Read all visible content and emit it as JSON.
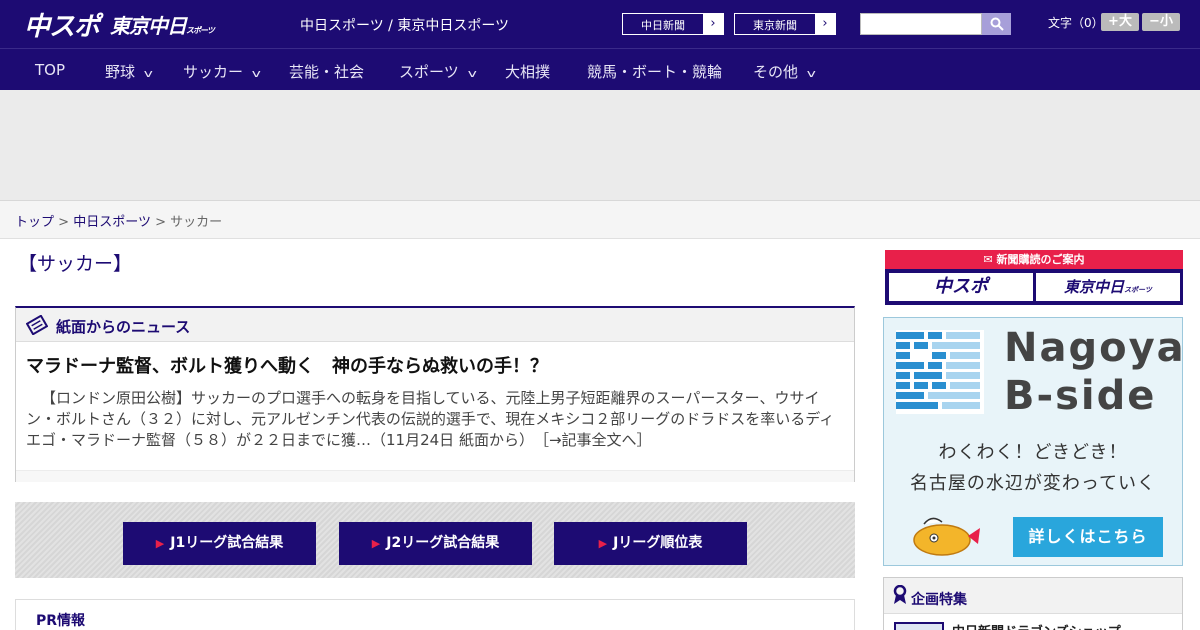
{
  "header": {
    "logo_chuspo": "中スポ",
    "logo_tokyo": "東京中日",
    "logo_tokyo_small": "スポーツ",
    "tagline": "中日スポーツ / 東京中日スポーツ",
    "paper_links": [
      "中日新聞",
      "東京新聞"
    ],
    "search_placeholder": "",
    "font_size_label": "文字（0）",
    "font_bigger": "+大",
    "font_smaller": "−小"
  },
  "nav": [
    {
      "label": "TOP",
      "has_dropdown": false
    },
    {
      "label": "野球",
      "has_dropdown": true
    },
    {
      "label": "サッカー",
      "has_dropdown": true
    },
    {
      "label": "芸能・社会",
      "has_dropdown": false
    },
    {
      "label": "スポーツ",
      "has_dropdown": true
    },
    {
      "label": "大相撲",
      "has_dropdown": false
    },
    {
      "label": "競馬・ボート・競輪",
      "has_dropdown": false
    },
    {
      "label": "その他",
      "has_dropdown": true
    }
  ],
  "breadcrumb": {
    "home": "トップ",
    "sep": ">",
    "section": "中日スポーツ",
    "current": "サッカー"
  },
  "page_title": "【サッカー】",
  "news": {
    "section_title": "紙面からのニュース",
    "headline": "マラドーナ監督、ボルト獲りへ動く　神の手ならぬ救いの手！？",
    "body": "【ロンドン原田公樹】サッカーのプロ選手への転身を目指している、元陸上男子短距離界のスーパースター、ウサイン・ボルトさん（３２）に対し、元アルゼンチン代表の伝説的選手で、現在メキシコ２部リーグのドラドスを率いるディエゴ・マラドーナ監督（５８）が２２日までに獲…（11月24日 紙面から）",
    "more_link": "［→記事全文へ］"
  },
  "results_buttons": [
    "J1リーグ試合結果",
    "J2リーグ試合結果",
    "Jリーグ順位表"
  ],
  "pr": {
    "title": "PR情報"
  },
  "sidebar": {
    "subscribe_label": "新聞購読のご案内",
    "subscribe_logos": [
      "中スポ",
      "東京中日"
    ],
    "subscribe_logo_small": "スポーツ",
    "bside_title_1": "Nagoya",
    "bside_title_2": "B-side",
    "bside_line_1": "わくわく！どきどき！",
    "bside_line_2": "名古屋の水辺が変わっていく",
    "bside_button": "詳しくはこちら",
    "feature_title": "企画特集",
    "feature_item": "中日新聞ドラゴンズショップ"
  },
  "colors": {
    "brand_navy": "#1d0b73",
    "accent_red": "#e8204a",
    "bside_blue": "#29a6dc"
  }
}
